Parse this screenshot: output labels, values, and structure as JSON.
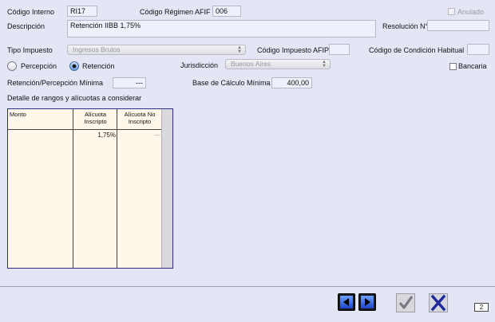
{
  "form": {
    "codigo_interno_label": "Código Interno",
    "codigo_interno_value": "RI17",
    "codigo_regimen_label": "Código Régimen AFIF",
    "codigo_regimen_value": "006",
    "anulado_label": "Anulado",
    "descripcion_label": "Descripción",
    "descripcion_value": "Retención IIBB 1,75%",
    "resolucion_label": "Resolución N°",
    "resolucion_value": "",
    "tipo_impuesto_label": "Tipo Impuesto",
    "tipo_impuesto_value": "Ingresos Brutos",
    "codigo_impuesto_afip_label": "Código Impuesto AFIP",
    "codigo_impuesto_afip_value": "",
    "codigo_condicion_label": "Código de Condición Habitual",
    "codigo_condicion_value": "",
    "percepcion_label": "Percepción",
    "retencion_label": "Retención",
    "jurisdiccion_label": "Jurisdicción",
    "jurisdiccion_value": "Buenos Aires",
    "bancaria_label": "Bancaria",
    "minima_label": "Retención/Percepción Mínima",
    "minima_value": "---",
    "base_label": "Base de Cálculo Mínima",
    "base_value": "400,00",
    "detalle_label": "Detalle de rangos y alícuotas a considerar"
  },
  "table": {
    "headers": [
      "Monto",
      "Alícuota Inscripto",
      "Alícuota No Inscripto"
    ],
    "rows": [
      [
        "",
        "1,75%",
        "---"
      ]
    ]
  },
  "footer": {
    "page_number": "2"
  },
  "colors": {
    "background": "#e4e6f6",
    "table_bg": "#fff8ea",
    "table_border": "#2a2c86",
    "nav_blue": "#1d46c9",
    "accept_check": "#7a7b82",
    "cancel_x": "#1f2b9a"
  },
  "icons": {
    "prev": "triangle-left-icon",
    "next": "triangle-right-icon",
    "accept": "checkmark-icon",
    "cancel": "x-icon"
  }
}
